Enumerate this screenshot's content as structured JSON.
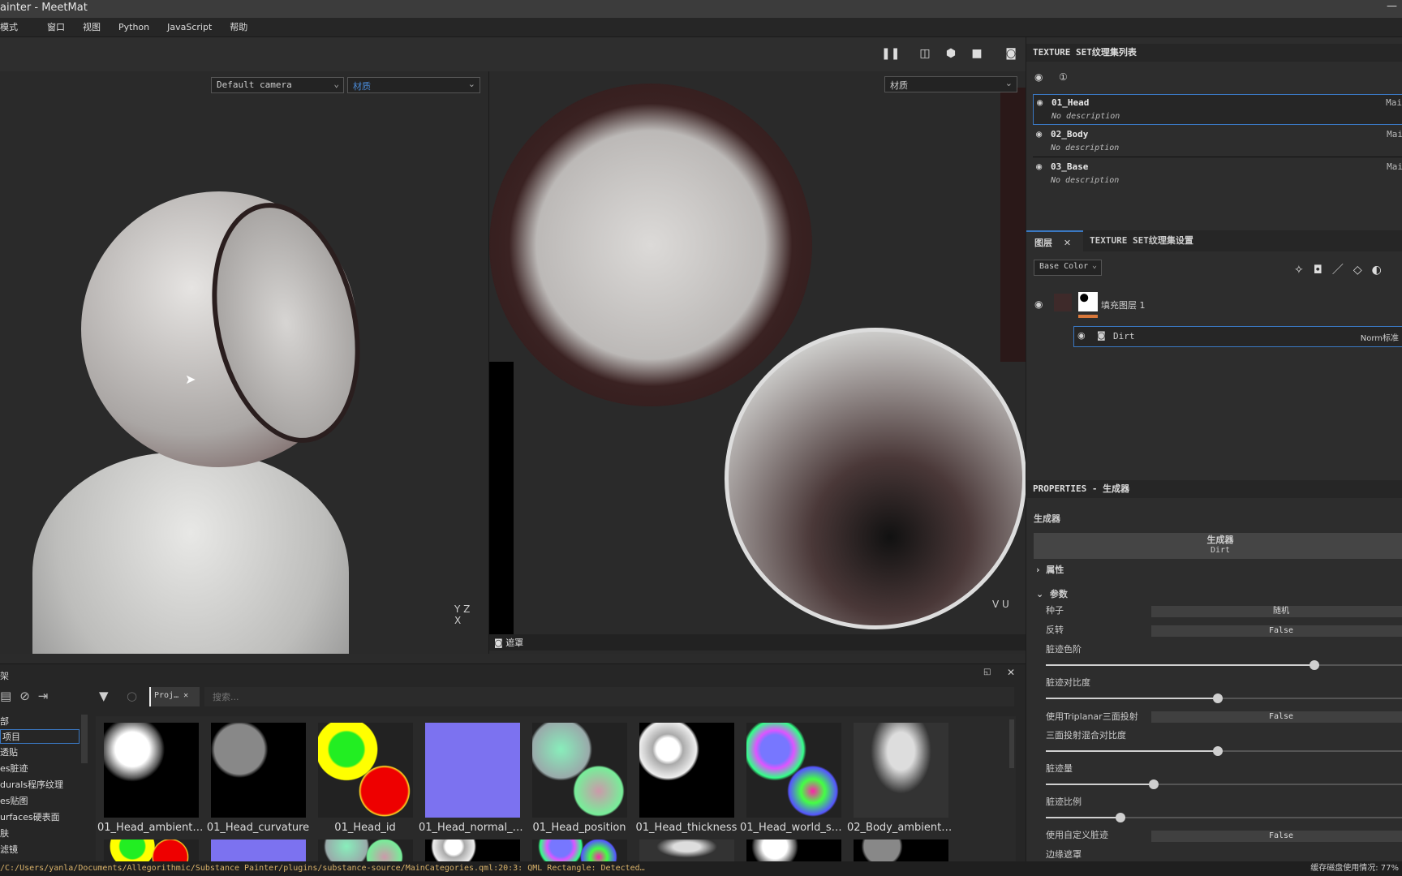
{
  "window": {
    "title": "ainter - MeetMat"
  },
  "menu": [
    "模式",
    "窗口",
    "视图",
    "Python",
    "JavaScript",
    "帮助"
  ],
  "toolbar": {
    "icons": [
      "pause-icon",
      "split-view-icon",
      "cube-icon",
      "camera-icon",
      "screenshot-icon"
    ]
  },
  "viewport3d": {
    "camera": "Default camera",
    "mode": "材质",
    "axes": [
      "Y",
      "Z",
      "X"
    ]
  },
  "viewport2d": {
    "mode": "材质",
    "mask_label": "遮罩",
    "axes": [
      "V",
      "U"
    ]
  },
  "texture_sets": {
    "title": "TEXTURE SET纹理集列表",
    "items": [
      {
        "name": "01_Head",
        "description": "No description",
        "material": "Mai",
        "selected": true
      },
      {
        "name": "02_Body",
        "description": "No description",
        "material": "Mai",
        "selected": false
      },
      {
        "name": "03_Base",
        "description": "No description",
        "material": "Mai",
        "selected": false
      }
    ]
  },
  "layers": {
    "tab_layers": "图层",
    "tab_settings": "TEXTURE SET纹理集设置",
    "channel": "Base Color",
    "fill_layer": "填充图层 1",
    "effect": {
      "name": "Dirt",
      "blend": "Norm标准"
    }
  },
  "properties": {
    "title": "PROPERTIES - 生成器",
    "section": "生成器",
    "generator_title": "生成器",
    "generator_name": "Dirt",
    "group_attributes": "属性",
    "group_params": "参数",
    "seed": {
      "label": "种子",
      "value": "随机"
    },
    "invert": {
      "label": "反转",
      "value": "False"
    },
    "sliders": [
      {
        "label": "脏迹色阶",
        "value": 0.72
      },
      {
        "label": "脏迹对比度",
        "value": 0.46
      }
    ],
    "triplanar": {
      "label": "使用Triplanar三面投射",
      "value": "False"
    },
    "sliders2": [
      {
        "label": "三面投射混合对比度",
        "value": 0.46
      },
      {
        "label": "脏迹量",
        "value": 0.29
      },
      {
        "label": "脏迹比例",
        "value": 0.2
      }
    ],
    "custom": {
      "label": "使用自定义脏迹",
      "value": "False"
    },
    "edge_mask": "边缘遮罩"
  },
  "shelf": {
    "title": "架",
    "tab": "Proj…",
    "search_placeholder": "搜索...",
    "categories": [
      "部",
      "项目",
      "透贴",
      "es脏迹",
      "durals程序纹理",
      "es贴图",
      "urfaces硬表面",
      "肤",
      "滤镜"
    ],
    "items": [
      "01_Head_ambient_...",
      "01_Head_curvature",
      "01_Head_id",
      "01_Head_normal_b...",
      "01_Head_position",
      "01_Head_thickness",
      "01_Head_world_sp...",
      "02_Body_ambient_..."
    ]
  },
  "status": {
    "log": "/C:/Users/yanla/Documents/Allegorithmic/Substance Painter/plugins/substance-source/MainCategories.qml:20:3: QML Rectangle: Detected…",
    "cache": "缓存磁盘使用情况:  77%"
  },
  "colors": {
    "accent": "#3a78c2",
    "orange": "#d8773a",
    "log": "#d9b26a"
  }
}
